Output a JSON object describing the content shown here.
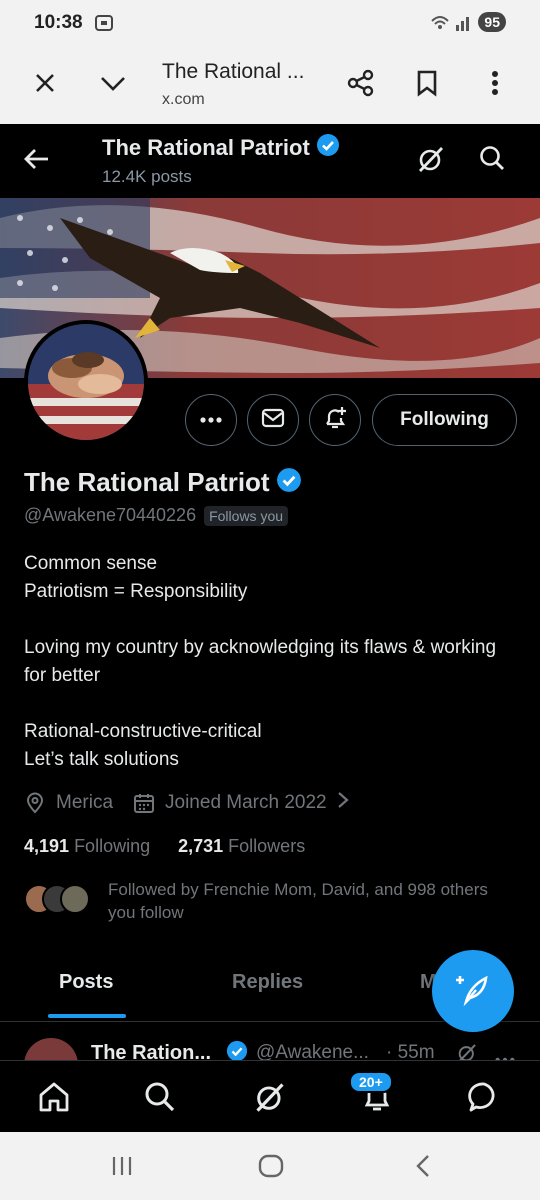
{
  "status_bar": {
    "time": "10:38",
    "battery": "95"
  },
  "browser": {
    "page_title": "The Rational ...",
    "url": "x.com"
  },
  "header": {
    "name": "The Rational Patriot",
    "posts_count": "12.4K posts"
  },
  "profile": {
    "name": "The Rational Patriot",
    "handle": "@Awakene70440226",
    "follows_you": "Follows you",
    "following_button": "Following",
    "bio": {
      "line1": "Common sense",
      "line2": "Patriotism = Responsibility",
      "line3": "Loving my country by acknowledging its flaws & working for better",
      "line4": "Rational-constructive-critical",
      "line5": "Let’s talk solutions"
    },
    "location": "Merica",
    "joined": "Joined March 2022",
    "following_count": "4,191",
    "following_label": "Following",
    "followers_count": "2,731",
    "followers_label": "Followers",
    "followed_by": "Followed by Frenchie Mom, David, and 998 others you follow"
  },
  "tabs": {
    "posts": "Posts",
    "replies": "Replies",
    "more": "M"
  },
  "post_preview": {
    "name": "The Ration...",
    "handle": "@Awakene...",
    "time": "· 55m"
  },
  "bottom_nav": {
    "notifications_badge": "20+"
  },
  "colors": {
    "accent": "#1d9bf0",
    "background": "#000000",
    "text": "#e7e9ea",
    "muted": "#71767b"
  },
  "icons": [
    "close-icon",
    "chevron-down-icon",
    "share-icon",
    "bookmark-icon",
    "more-vert-icon",
    "back-arrow-icon",
    "verified-badge-icon",
    "grok-icon",
    "search-icon",
    "more-horiz-icon",
    "mail-icon",
    "notification-plus-icon",
    "location-icon",
    "calendar-icon",
    "compose-icon",
    "home-icon",
    "bell-icon",
    "chat-icon"
  ]
}
